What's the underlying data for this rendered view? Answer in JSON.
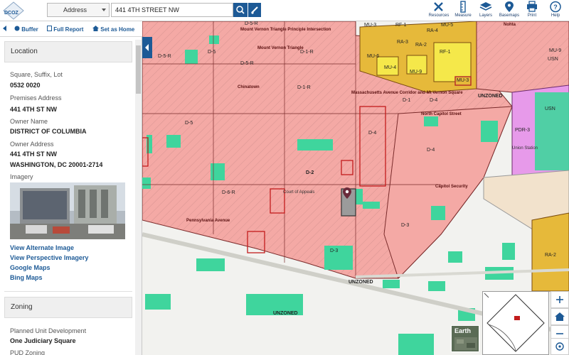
{
  "header": {
    "logo_text": "DCOZ",
    "search_type": "Address",
    "search_value": "441 4TH STREET NW",
    "tools": [
      {
        "label": "Resources",
        "icon": "tools-icon"
      },
      {
        "label": "Measure",
        "icon": "ruler-icon"
      },
      {
        "label": "Layers",
        "icon": "layers-icon"
      },
      {
        "label": "Basemaps",
        "icon": "map-pin-icon"
      },
      {
        "label": "Print",
        "icon": "print-icon"
      },
      {
        "label": "Help",
        "icon": "help-icon"
      }
    ]
  },
  "subbar": {
    "buffer": "Buffer",
    "full_report": "Full Report",
    "set_home": "Set as Home"
  },
  "location": {
    "title": "Location",
    "square_label": "Square, Suffix, Lot",
    "square_value": "0532 0020",
    "premises_label": "Premises Address",
    "premises_value": "441 4TH ST NW",
    "owner_label": "Owner Name",
    "owner_value": "DISTRICT OF COLUMBIA",
    "owner_addr_label": "Owner Address",
    "owner_addr_line1": "441 4TH ST NW",
    "owner_addr_line2": "WASHINGTON, DC 20001-2714",
    "imagery_label": "Imagery",
    "links": [
      "View Alternate Image",
      "View Perspective Imagery",
      "Google Maps",
      "Bing Maps"
    ]
  },
  "zoning": {
    "title": "Zoning",
    "pud_label": "Planned Unit Development",
    "pud_value": "One Judiciary Square",
    "pud_zoning_label": "PUD Zoning"
  },
  "map": {
    "colors": {
      "d_zone": "#f4a9a5",
      "mu_zone": "#e6b93a",
      "rf_zone": "#f5e84a",
      "pdr_zone": "#e79aea",
      "park": "#3fd59d",
      "usn_zone": "#f2e2cc"
    },
    "zone_labels": [
      "D-5-R",
      "D-5",
      "D-5-R",
      "D-1-R",
      "D-5-R",
      "D-1-R",
      "D-5",
      "D-2",
      "D-4",
      "D-6-R",
      "D-3",
      "D-4",
      "D-1",
      "D-4",
      "D-3",
      "MU-3",
      "RF-1",
      "RA-4",
      "MU-5",
      "MU-6",
      "RA-3",
      "RA-2",
      "RF-1",
      "MU-4",
      "MU-9",
      "MU-3",
      "MU-9",
      "USN",
      "USN",
      "PDR-3",
      "UNZONED",
      "UNZONED",
      "UNZONED",
      "RA-2"
    ],
    "place_labels": [
      "Mount Vernon Triangle Principle Intersection",
      "Mount Vernon Triangle",
      "Massachusetts Avenue Corridor and Mt Vernon Square",
      "North Capitol Street",
      "Capitol Security",
      "Pennsylvania Avenue",
      "Chinatown",
      "Union Station",
      "Court of Appeals",
      "Nohta"
    ],
    "earth_label": "Earth"
  }
}
